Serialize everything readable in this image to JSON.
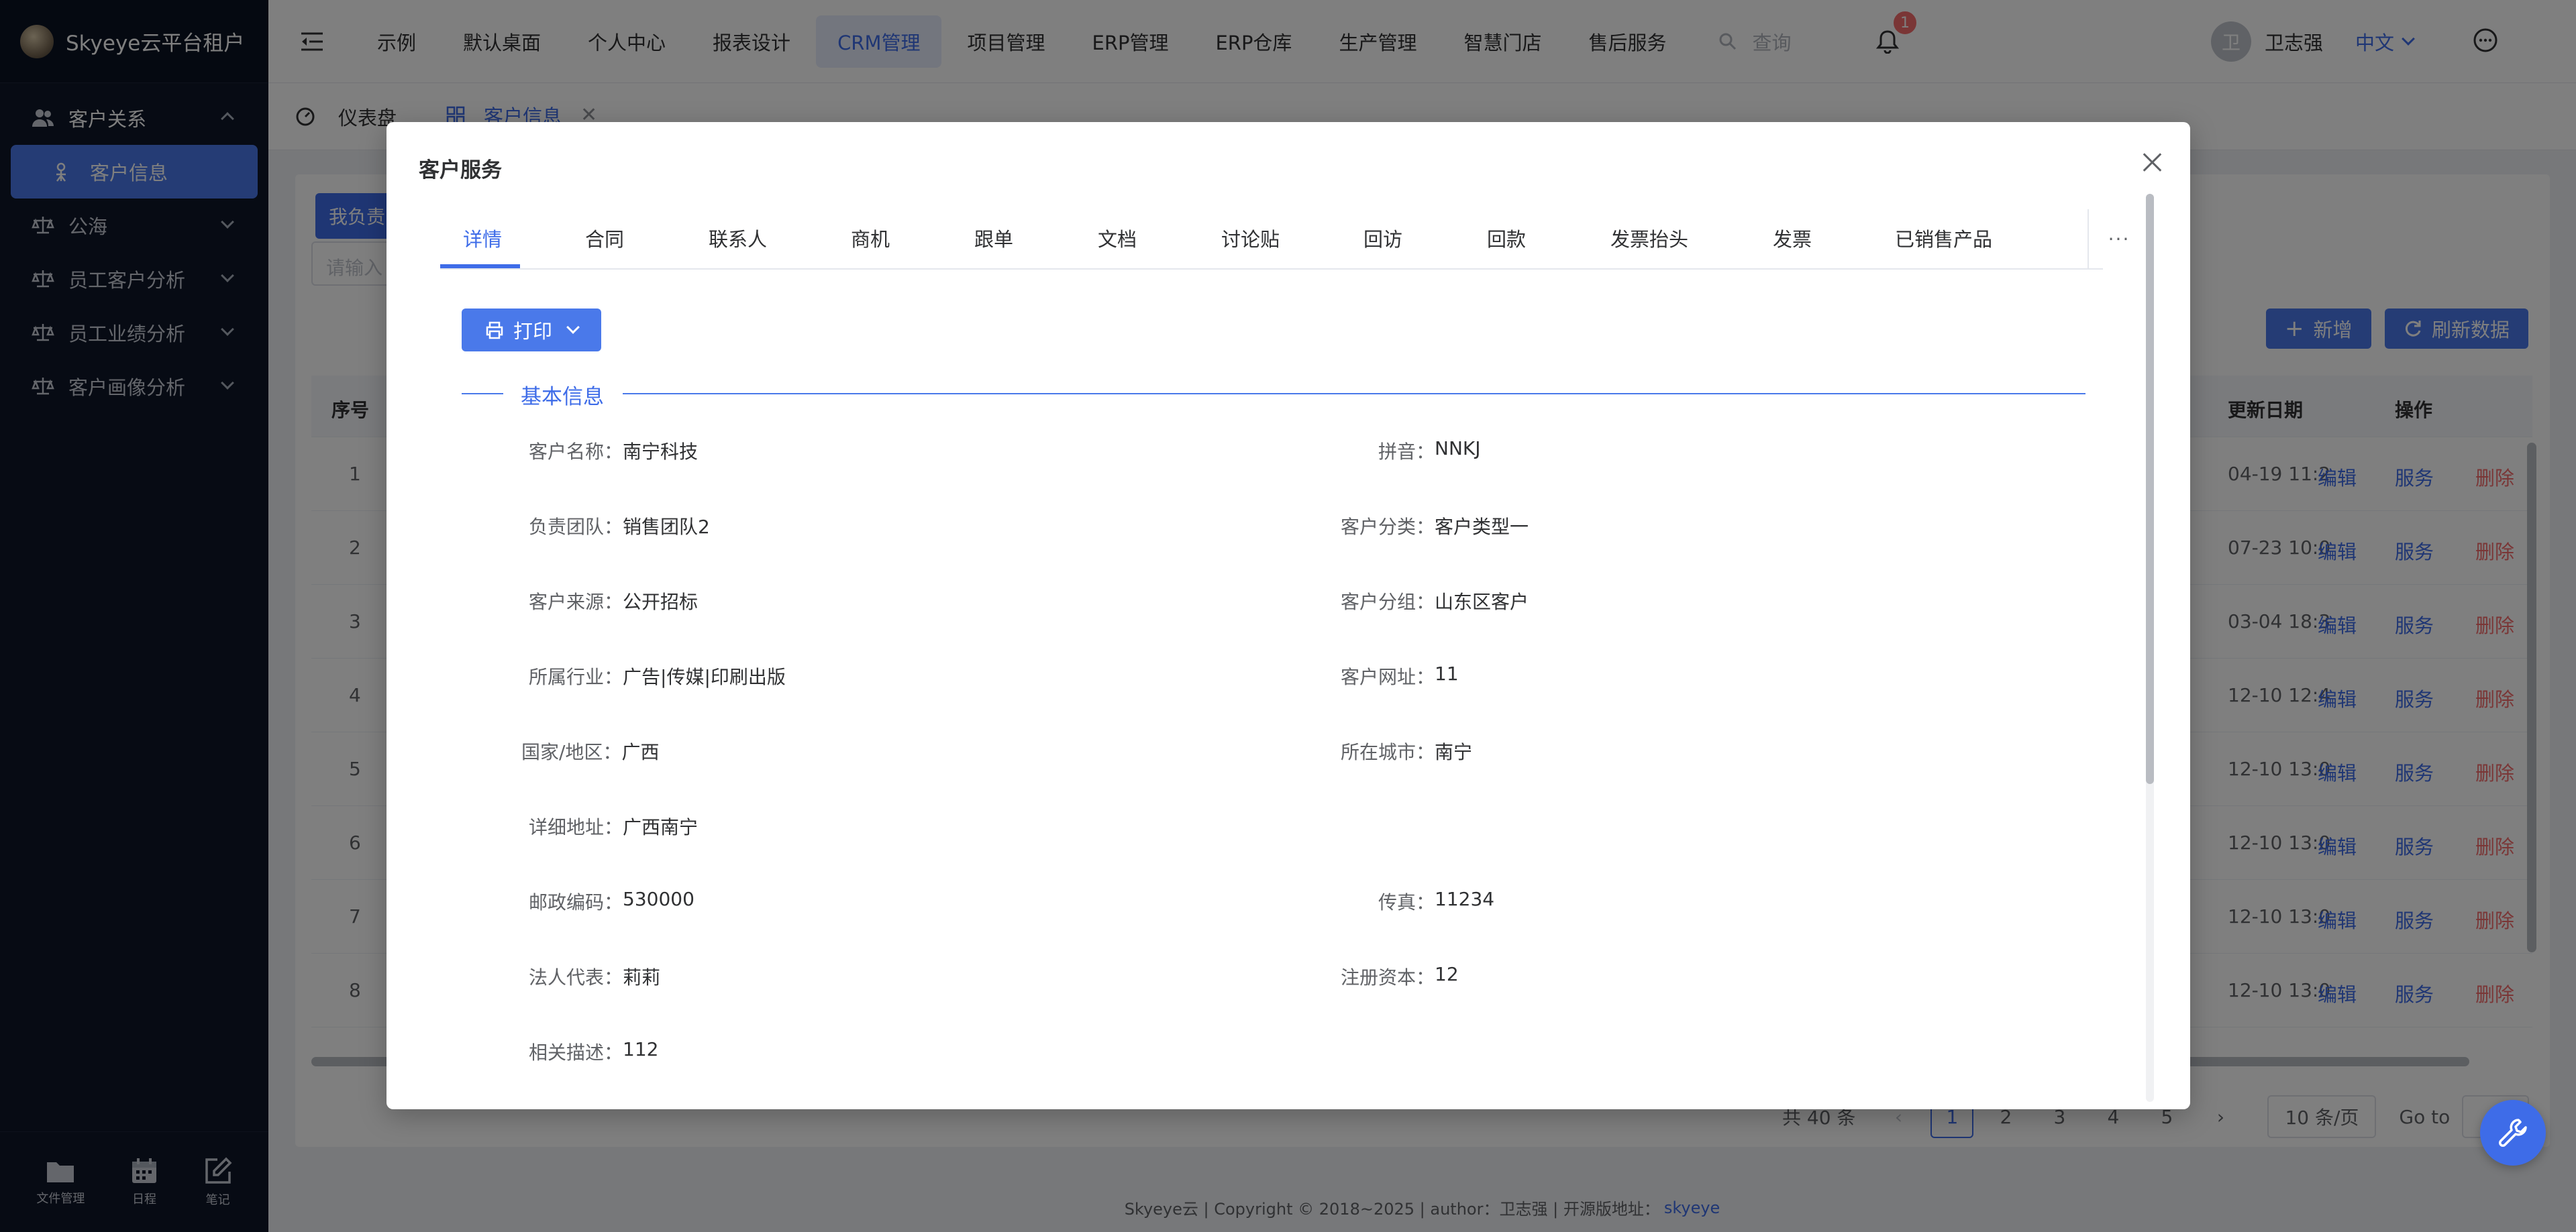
{
  "brand": {
    "name": "Skyeye云平台租户"
  },
  "sidebar": {
    "items": [
      {
        "label": "客户关系"
      },
      {
        "label": "客户信息"
      },
      {
        "label": "公海"
      },
      {
        "label": "员工客户分析"
      },
      {
        "label": "员工业绩分析"
      },
      {
        "label": "客户画像分析"
      }
    ],
    "tools": [
      {
        "label": "文件管理"
      },
      {
        "label": "日程"
      },
      {
        "label": "笔记"
      }
    ]
  },
  "topnav": {
    "items": [
      "示例",
      "默认桌面",
      "个人中心",
      "报表设计",
      "CRM管理",
      "项目管理",
      "ERP管理",
      "ERP仓库",
      "生产管理",
      "智慧门店",
      "售后服务"
    ],
    "active": "CRM管理",
    "search_placeholder": "查询",
    "notification_count": "1",
    "user_initial": "卫",
    "user_name": "卫志强",
    "language": "中文"
  },
  "tabs": {
    "home": "仪表盘",
    "active": "客户信息"
  },
  "background": {
    "chip": "我负责",
    "input_placeholder": "请输入",
    "add_button": "新增",
    "refresh_button": "刷新数据",
    "headers": {
      "seq": "序号",
      "date": "更新日期",
      "ops": "操作"
    },
    "rows": [
      {
        "idx": "1",
        "date": "04-19 11:2"
      },
      {
        "idx": "2",
        "date": "07-23 10:0"
      },
      {
        "idx": "3",
        "date": "03-04 18:3"
      },
      {
        "idx": "4",
        "date": "12-10 12:4"
      },
      {
        "idx": "5",
        "date": "12-10 13:0"
      },
      {
        "idx": "6",
        "date": "12-10 13:0"
      },
      {
        "idx": "7",
        "date": "12-10 13:0"
      },
      {
        "idx": "8",
        "date": "12-10 13:0"
      }
    ],
    "row_actions": {
      "edit": "编辑",
      "serve": "服务",
      "delete": "删除"
    },
    "pager": {
      "total": "共 40 条",
      "pages": [
        "1",
        "2",
        "3",
        "4",
        "5"
      ],
      "current": "1",
      "size": "10 条/页",
      "goto": "Go to"
    }
  },
  "footer": {
    "text": "Skyeye云 | Copyright © 2018~2025 | author：卫志强 | 开源版地址：",
    "link": "skyeye"
  },
  "modal": {
    "title": "客户服务",
    "tabs": [
      "详情",
      "合同",
      "联系人",
      "商机",
      "跟单",
      "文档",
      "讨论贴",
      "回访",
      "回款",
      "发票抬头",
      "发票",
      "已销售产品"
    ],
    "active_tab": "详情",
    "more": "···",
    "print_button": "打印",
    "section_title": "基本信息",
    "fields": {
      "customer_name": {
        "label": "客户名称：",
        "value": "南宁科技"
      },
      "pinyin": {
        "label": "拼音：",
        "value": "NNKJ"
      },
      "team": {
        "label": "负责团队：",
        "value": "销售团队2"
      },
      "category": {
        "label": "客户分类：",
        "value": "客户类型一"
      },
      "source": {
        "label": "客户来源：",
        "value": "公开招标"
      },
      "group": {
        "label": "客户分组：",
        "value": "山东区客户"
      },
      "industry": {
        "label": "所属行业：",
        "value": "广告|传媒|印刷出版"
      },
      "website": {
        "label": "客户网址：",
        "value": "11"
      },
      "region": {
        "label": "国家/地区：",
        "value": "广西"
      },
      "city": {
        "label": "所在城市：",
        "value": "南宁"
      },
      "address": {
        "label": "详细地址：",
        "value": "广西南宁"
      },
      "postcode": {
        "label": "邮政编码：",
        "value": "530000"
      },
      "fax": {
        "label": "传真：",
        "value": "11234"
      },
      "legal_rep": {
        "label": "法人代表：",
        "value": "莉莉"
      },
      "capital": {
        "label": "注册资本：",
        "value": "12"
      },
      "description": {
        "label": "相关描述：",
        "value": "112"
      }
    }
  }
}
